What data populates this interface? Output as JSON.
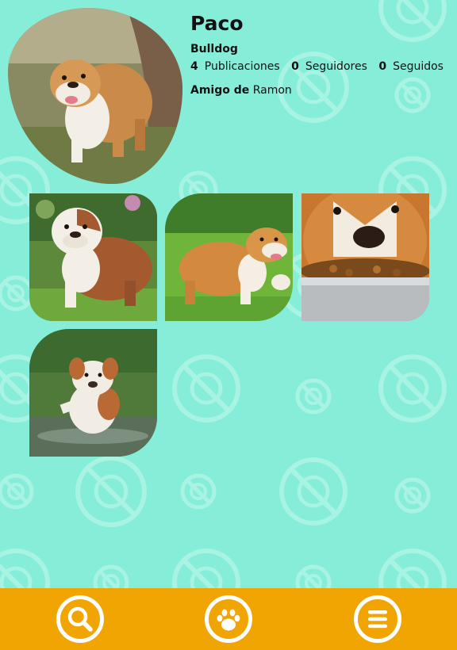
{
  "profile": {
    "name": "Paco",
    "breed": "Bulldog",
    "stats": [
      {
        "count": "4",
        "label": "Publicaciones"
      },
      {
        "count": "0",
        "label": "Seguidores"
      },
      {
        "count": "0",
        "label": "Seguidos"
      }
    ],
    "friend_label": "Amigo de",
    "friend_name": "Ramon",
    "photo_icon": "bulldog-photo"
  },
  "posts": [
    {
      "icon": "bulldog-standing-photo"
    },
    {
      "icon": "bulldog-running-photo"
    },
    {
      "icon": "bulldog-eating-photo"
    },
    {
      "icon": "bulldog-puppy-water-photo"
    }
  ],
  "nav": [
    {
      "icon": "search-icon"
    },
    {
      "icon": "paw-icon"
    },
    {
      "icon": "menu-icon"
    }
  ],
  "colors": {
    "background": "#86eed8",
    "pattern": "#a8f3e2",
    "bottom_bar": "#f0a502",
    "nav_icon": "#ffffff"
  }
}
